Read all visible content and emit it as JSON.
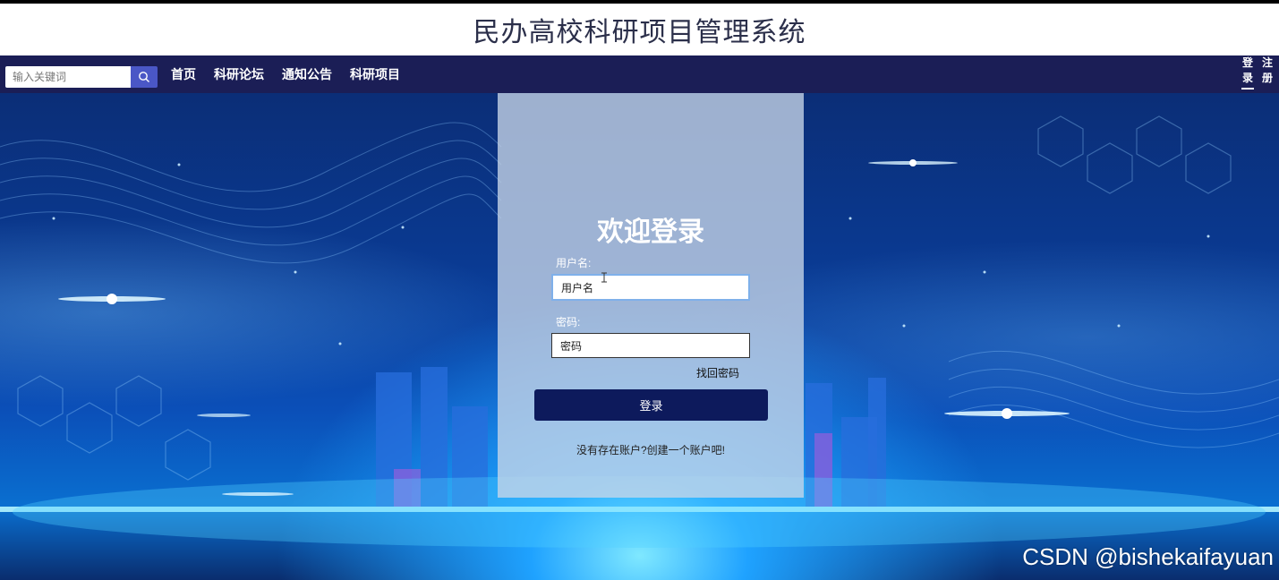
{
  "header": {
    "title": "民办高校科研项目管理系统"
  },
  "navbar": {
    "search": {
      "placeholder": "输入关键词",
      "icon": "search-icon"
    },
    "links": [
      "首页",
      "科研论坛",
      "通知公告",
      "科研项目"
    ],
    "auth": {
      "login": "登录",
      "register": "注册"
    }
  },
  "login": {
    "title": "欢迎登录",
    "username_label": "用户名:",
    "username_value": "用户名",
    "password_label": "密码:",
    "password_value": "密码",
    "forgot": "找回密码",
    "submit": "登录",
    "register_prompt": "没有存在账户?创建一个账户吧!"
  },
  "watermark": "CSDN @bishekaifayuan",
  "colors": {
    "navbar": "#1b1e56",
    "accent": "#4a57c6",
    "button": "#0d1a5c"
  }
}
